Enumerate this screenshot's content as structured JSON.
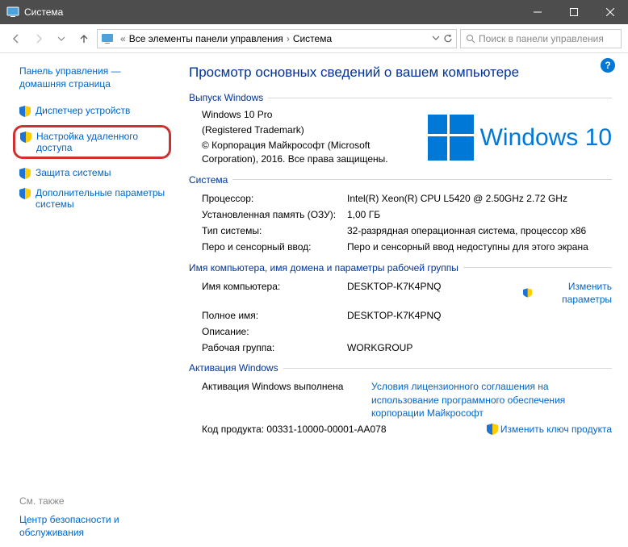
{
  "window": {
    "title": "Система"
  },
  "breadcrumb": {
    "prefix": "«",
    "parent": "Все элементы панели управления",
    "current": "Система"
  },
  "search": {
    "placeholder": "Поиск в панели управления"
  },
  "sidebar": {
    "home": "Панель управления — домашняя страница",
    "items": [
      {
        "label": "Диспетчер устройств"
      },
      {
        "label": "Настройка удаленного доступа"
      },
      {
        "label": "Защита системы"
      },
      {
        "label": "Дополнительные параметры системы"
      }
    ],
    "see_also_title": "См. также",
    "see_also": "Центр безопасности и обслуживания"
  },
  "heading": "Просмотр основных сведений о вашем компьютере",
  "edition": {
    "group_title": "Выпуск Windows",
    "line1": "Windows 10 Pro",
    "line2": "(Registered Trademark)",
    "line3": "© Корпорация Майкрософт (Microsoft Corporation), 2016. Все права защищены.",
    "logo_text": "Windows 10"
  },
  "system": {
    "group_title": "Система",
    "rows": [
      {
        "label": "Процессор:",
        "value": "Intel(R) Xeon(R) CPU           L5420  @ 2.50GHz   2.72 GHz"
      },
      {
        "label": "Установленная память (ОЗУ):",
        "value": "1,00 ГБ"
      },
      {
        "label": "Тип системы:",
        "value": "32-разрядная операционная система, процессор x86"
      },
      {
        "label": "Перо и сенсорный ввод:",
        "value": "Перо и сенсорный ввод недоступны для этого экрана"
      }
    ]
  },
  "computer": {
    "group_title": "Имя компьютера, имя домена и параметры рабочей группы",
    "rows": [
      {
        "label": "Имя компьютера:",
        "value": "DESKTOP-K7K4PNQ"
      },
      {
        "label": "Полное имя:",
        "value": "DESKTOP-K7K4PNQ"
      },
      {
        "label": "Описание:",
        "value": ""
      },
      {
        "label": "Рабочая группа:",
        "value": "WORKGROUP"
      }
    ],
    "change_label": "Изменить параметры"
  },
  "activation": {
    "group_title": "Активация Windows",
    "status_label": "Активация Windows выполнена",
    "terms_text": "Условия лицензионного соглашения на использование программного обеспечения корпорации Майкрософт",
    "product_key_label": "Код продукта: 00331-10000-00001-AA078",
    "change_key_label": "Изменить ключ продукта"
  }
}
